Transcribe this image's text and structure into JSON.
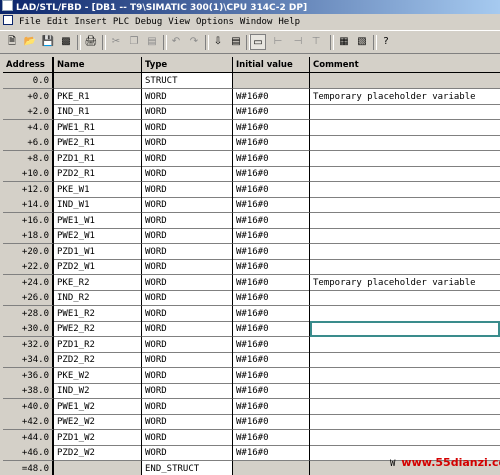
{
  "window": {
    "title": "LAD/STL/FBD - [DB1 -- T9\\SIMATIC 300(1)\\CPU 314C-2 DP]"
  },
  "menu": [
    "File",
    "Edit",
    "Insert",
    "PLC",
    "Debug",
    "View",
    "Options",
    "Window",
    "Help"
  ],
  "toolbar_icons": [
    "new-icon",
    "open-icon",
    "save-icon",
    "print-icon",
    "cut-icon",
    "copy-icon",
    "paste-icon",
    "undo-icon",
    "redo-icon",
    "download-icon",
    "monitor-icon",
    "overview-icon",
    "network-icon",
    "branch-icon",
    "declaration-icon",
    "details-icon",
    "help-icon"
  ],
  "table": {
    "headers": [
      "Address",
      "Name",
      "Type",
      "Initial value",
      "Comment"
    ],
    "rows": [
      {
        "address": "0.0",
        "name": "",
        "type": "STRUCT",
        "initial": "",
        "comment": ""
      },
      {
        "address": "+0.0",
        "name": "PKE_R1",
        "type": "WORD",
        "initial": "W#16#0",
        "comment": "Temporary placeholder variable"
      },
      {
        "address": "+2.0",
        "name": "IND_R1",
        "type": "WORD",
        "initial": "W#16#0",
        "comment": ""
      },
      {
        "address": "+4.0",
        "name": "PWE1_R1",
        "type": "WORD",
        "initial": "W#16#0",
        "comment": ""
      },
      {
        "address": "+6.0",
        "name": "PWE2_R1",
        "type": "WORD",
        "initial": "W#16#0",
        "comment": ""
      },
      {
        "address": "+8.0",
        "name": "PZD1_R1",
        "type": "WORD",
        "initial": "W#16#0",
        "comment": ""
      },
      {
        "address": "+10.0",
        "name": "PZD2_R1",
        "type": "WORD",
        "initial": "W#16#0",
        "comment": ""
      },
      {
        "address": "+12.0",
        "name": "PKE_W1",
        "type": "WORD",
        "initial": "W#16#0",
        "comment": ""
      },
      {
        "address": "+14.0",
        "name": "IND_W1",
        "type": "WORD",
        "initial": "W#16#0",
        "comment": ""
      },
      {
        "address": "+16.0",
        "name": "PWE1_W1",
        "type": "WORD",
        "initial": "W#16#0",
        "comment": ""
      },
      {
        "address": "+18.0",
        "name": "PWE2_W1",
        "type": "WORD",
        "initial": "W#16#0",
        "comment": ""
      },
      {
        "address": "+20.0",
        "name": "PZD1_W1",
        "type": "WORD",
        "initial": "W#16#0",
        "comment": ""
      },
      {
        "address": "+22.0",
        "name": "PZD2_W1",
        "type": "WORD",
        "initial": "W#16#0",
        "comment": ""
      },
      {
        "address": "+24.0",
        "name": "PKE_R2",
        "type": "WORD",
        "initial": "W#16#0",
        "comment": "Temporary placeholder variable"
      },
      {
        "address": "+26.0",
        "name": "IND_R2",
        "type": "WORD",
        "initial": "W#16#0",
        "comment": ""
      },
      {
        "address": "+28.0",
        "name": "PWE1_R2",
        "type": "WORD",
        "initial": "W#16#0",
        "comment": ""
      },
      {
        "address": "+30.0",
        "name": "PWE2_R2",
        "type": "WORD",
        "initial": "W#16#0",
        "comment": ""
      },
      {
        "address": "+32.0",
        "name": "PZD1_R2",
        "type": "WORD",
        "initial": "W#16#0",
        "comment": ""
      },
      {
        "address": "+34.0",
        "name": "PZD2_R2",
        "type": "WORD",
        "initial": "W#16#0",
        "comment": ""
      },
      {
        "address": "+36.0",
        "name": "PKE_W2",
        "type": "WORD",
        "initial": "W#16#0",
        "comment": ""
      },
      {
        "address": "+38.0",
        "name": "IND_W2",
        "type": "WORD",
        "initial": "W#16#0",
        "comment": ""
      },
      {
        "address": "+40.0",
        "name": "PWE1_W2",
        "type": "WORD",
        "initial": "W#16#0",
        "comment": ""
      },
      {
        "address": "+42.0",
        "name": "PWE2_W2",
        "type": "WORD",
        "initial": "W#16#0",
        "comment": ""
      },
      {
        "address": "+44.0",
        "name": "PZD1_W2",
        "type": "WORD",
        "initial": "W#16#0",
        "comment": ""
      },
      {
        "address": "+46.0",
        "name": "PZD2_W2",
        "type": "WORD",
        "initial": "W#16#0",
        "comment": ""
      },
      {
        "address": "=48.0",
        "name": "",
        "type": "END_STRUCT",
        "initial": "",
        "comment": ""
      }
    ]
  },
  "watermark": {
    "prefix": "W",
    "text": "www.55dianzi.com"
  }
}
